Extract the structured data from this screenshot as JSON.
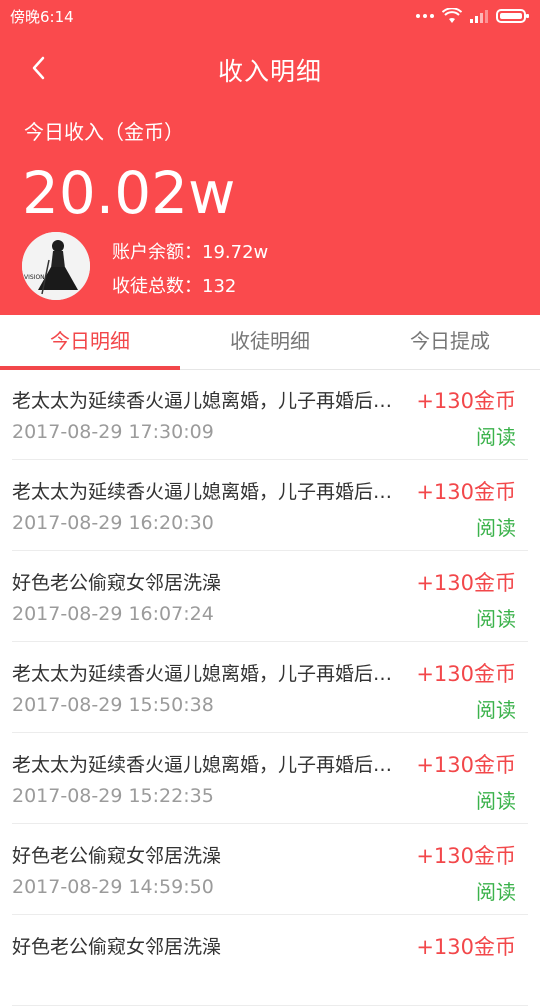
{
  "status_bar": {
    "time": "傍晚6:14"
  },
  "header": {
    "title": "收入明细",
    "today_label": "今日收入（金币）",
    "today_amount": "20.02w",
    "balance": "账户余额：19.72w",
    "disciples": "收徒总数：132"
  },
  "tabs": [
    {
      "label": "今日明细",
      "active": true
    },
    {
      "label": "收徒明细",
      "active": false
    },
    {
      "label": "今日提成",
      "active": false
    }
  ],
  "records": [
    {
      "title": "老太太为延续香火逼儿媳离婚，儿子再婚后…",
      "time": "2017-08-29 17:30:09",
      "coins": "+130金币",
      "type": "阅读"
    },
    {
      "title": "老太太为延续香火逼儿媳离婚，儿子再婚后…",
      "time": "2017-08-29 16:20:30",
      "coins": "+130金币",
      "type": "阅读"
    },
    {
      "title": "好色老公偷窥女邻居洗澡",
      "time": "2017-08-29 16:07:24",
      "coins": "+130金币",
      "type": "阅读"
    },
    {
      "title": "老太太为延续香火逼儿媳离婚，儿子再婚后…",
      "time": "2017-08-29 15:50:38",
      "coins": "+130金币",
      "type": "阅读"
    },
    {
      "title": "老太太为延续香火逼儿媳离婚，儿子再婚后…",
      "time": "2017-08-29 15:22:35",
      "coins": "+130金币",
      "type": "阅读"
    },
    {
      "title": "好色老公偷窥女邻居洗澡",
      "time": "2017-08-29 14:59:50",
      "coins": "+130金币",
      "type": "阅读"
    },
    {
      "title": "好色老公偷窥女邻居洗澡",
      "time": "",
      "coins": "+130金币",
      "type": ""
    }
  ],
  "colors": {
    "header": "#fa4a4d",
    "accent": "#f2474a",
    "read": "#3bb24b"
  },
  "icons": [
    "back-arrow-icon",
    "more-dots-icon",
    "wifi-icon",
    "signal-icon",
    "battery-icon"
  ]
}
